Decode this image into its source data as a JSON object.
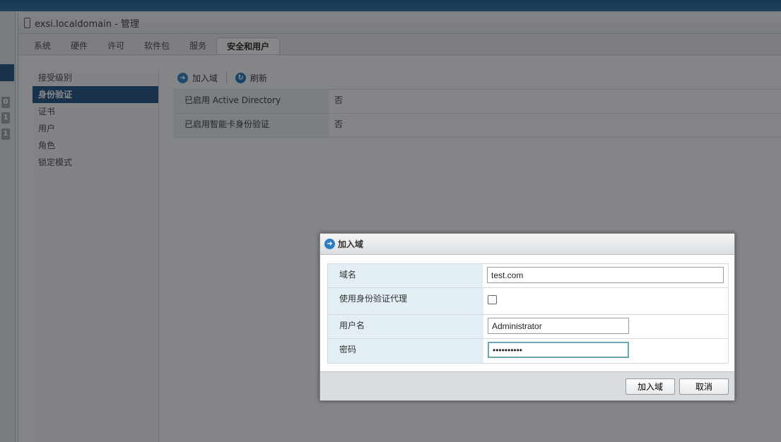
{
  "window": {
    "title": "exsi.localdomain - 管理"
  },
  "left_badges": [
    "0",
    "1",
    "1"
  ],
  "tabs": [
    {
      "label": "系统"
    },
    {
      "label": "硬件"
    },
    {
      "label": "许可"
    },
    {
      "label": "软件包"
    },
    {
      "label": "服务"
    },
    {
      "label": "安全和用户",
      "active": true
    }
  ],
  "nav": [
    {
      "label": "接受级别"
    },
    {
      "label": "身份验证",
      "selected": true
    },
    {
      "label": "证书"
    },
    {
      "label": "用户"
    },
    {
      "label": "角色"
    },
    {
      "label": "锁定模式"
    }
  ],
  "toolbar": {
    "join_domain": "加入域",
    "refresh": "刷新"
  },
  "info": [
    {
      "key": "已启用 Active Directory",
      "value": "否"
    },
    {
      "key": "已启用智能卡身份验证",
      "value": "否"
    }
  ],
  "dialog": {
    "title": "加入域",
    "domain_label": "域名",
    "domain_value": "test.com",
    "proxy_label": "使用身份验证代理",
    "proxy_checked": false,
    "user_label": "用户名",
    "user_value": "Administrator",
    "password_label": "密码",
    "password_value": "••••••••••",
    "ok": "加入域",
    "cancel": "取消"
  }
}
